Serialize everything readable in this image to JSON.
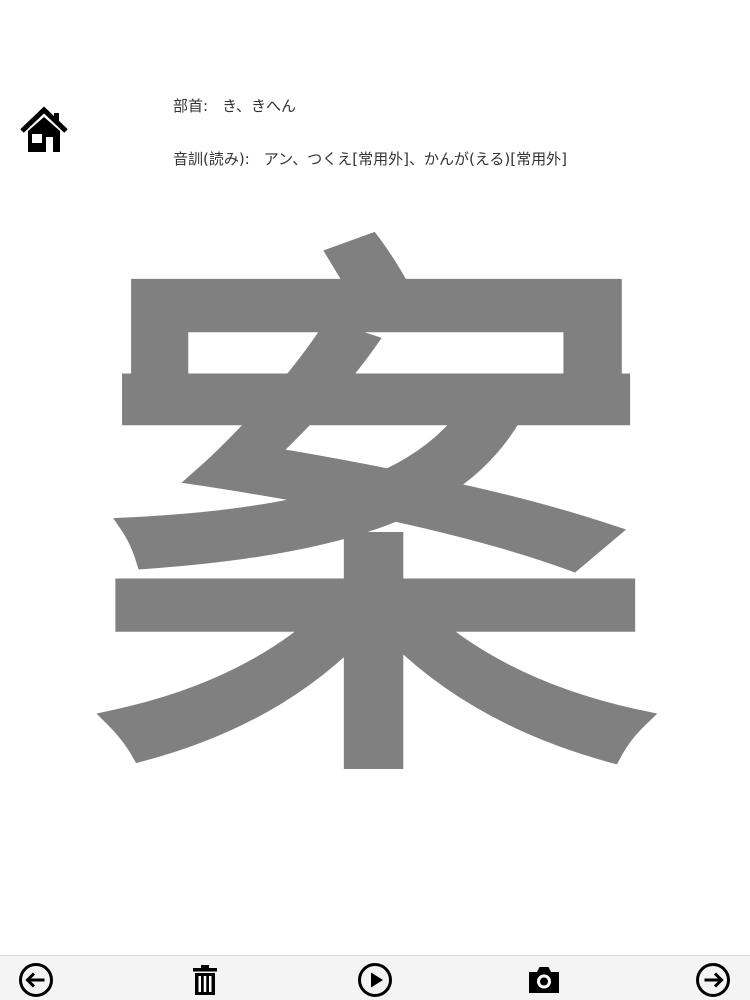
{
  "info": {
    "radical_label": "部首:",
    "radical_value": "き、きへん",
    "reading_label": "音訓(読み):",
    "reading_value": "アン、つくえ[常用外]、かんが(える)[常用外]"
  },
  "kanji": {
    "character": "案",
    "color": "#808080"
  },
  "icons": {
    "home": "home-icon",
    "prev": "arrow-left-circle-icon",
    "trash": "trash-icon",
    "play": "play-circle-icon",
    "camera": "camera-icon",
    "next": "arrow-right-circle-icon"
  },
  "colors": {
    "icon": "#000000",
    "toolbar_bg": "#f4f4f4",
    "text": "#333333"
  }
}
